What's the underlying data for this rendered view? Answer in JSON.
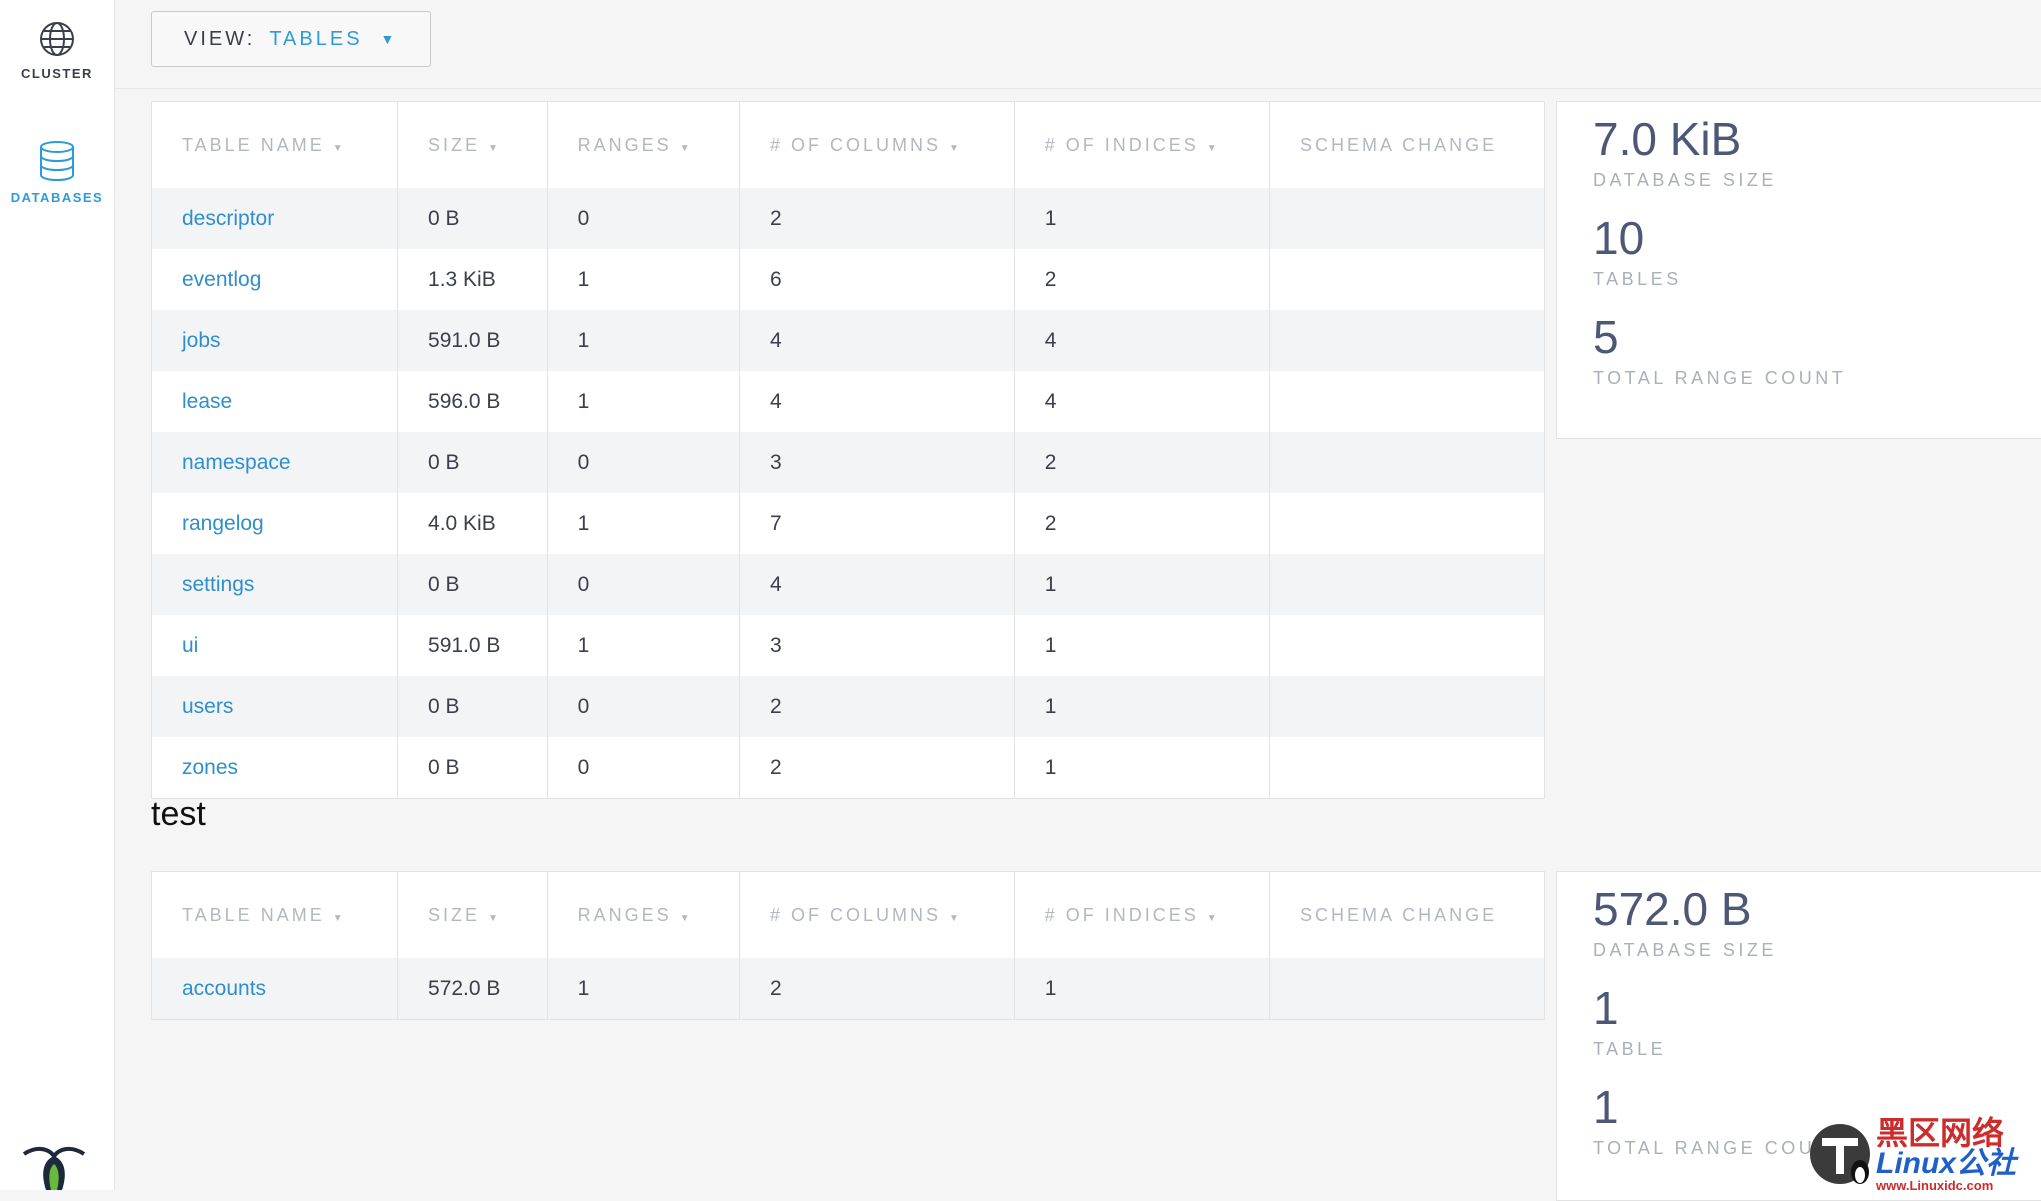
{
  "sidebar": {
    "items": [
      {
        "label": "CLUSTER",
        "icon": "globe-icon",
        "active": false
      },
      {
        "label": "DATABASES",
        "icon": "database-icon",
        "active": true
      }
    ],
    "accent": "#2e9bd8"
  },
  "view_select": {
    "label": "VIEW:",
    "value": "TABLES"
  },
  "table_headers": [
    "TABLE NAME",
    "SIZE",
    "RANGES",
    "# OF COLUMNS",
    "# OF INDICES",
    "SCHEMA CHANGE"
  ],
  "databases": [
    {
      "name": "",
      "rows": [
        {
          "name": "descriptor",
          "size": "0 B",
          "ranges": "0",
          "columns": "2",
          "indices": "1",
          "schema_change": ""
        },
        {
          "name": "eventlog",
          "size": "1.3 KiB",
          "ranges": "1",
          "columns": "6",
          "indices": "2",
          "schema_change": ""
        },
        {
          "name": "jobs",
          "size": "591.0 B",
          "ranges": "1",
          "columns": "4",
          "indices": "4",
          "schema_change": ""
        },
        {
          "name": "lease",
          "size": "596.0 B",
          "ranges": "1",
          "columns": "4",
          "indices": "4",
          "schema_change": ""
        },
        {
          "name": "namespace",
          "size": "0 B",
          "ranges": "0",
          "columns": "3",
          "indices": "2",
          "schema_change": ""
        },
        {
          "name": "rangelog",
          "size": "4.0 KiB",
          "ranges": "1",
          "columns": "7",
          "indices": "2",
          "schema_change": ""
        },
        {
          "name": "settings",
          "size": "0 B",
          "ranges": "0",
          "columns": "4",
          "indices": "1",
          "schema_change": ""
        },
        {
          "name": "ui",
          "size": "591.0 B",
          "ranges": "1",
          "columns": "3",
          "indices": "1",
          "schema_change": ""
        },
        {
          "name": "users",
          "size": "0 B",
          "ranges": "0",
          "columns": "2",
          "indices": "1",
          "schema_change": ""
        },
        {
          "name": "zones",
          "size": "0 B",
          "ranges": "0",
          "columns": "2",
          "indices": "1",
          "schema_change": ""
        }
      ],
      "summary": [
        {
          "value": "7.0 KiB",
          "label": "DATABASE SIZE"
        },
        {
          "value": "10",
          "label": "TABLES"
        },
        {
          "value": "5",
          "label": "TOTAL RANGE COUNT"
        }
      ]
    },
    {
      "name": "test",
      "rows": [
        {
          "name": "accounts",
          "size": "572.0 B",
          "ranges": "1",
          "columns": "2",
          "indices": "1",
          "schema_change": ""
        }
      ],
      "summary": [
        {
          "value": "572.0 B",
          "label": "DATABASE SIZE"
        },
        {
          "value": "1",
          "label": "TABLE"
        },
        {
          "value": "1",
          "label": "TOTAL RANGE COUNT"
        }
      ]
    }
  ],
  "watermark": {
    "cn": "黑区网络",
    "en": "Linux公社",
    "url": "www.Linuxidc.com"
  }
}
